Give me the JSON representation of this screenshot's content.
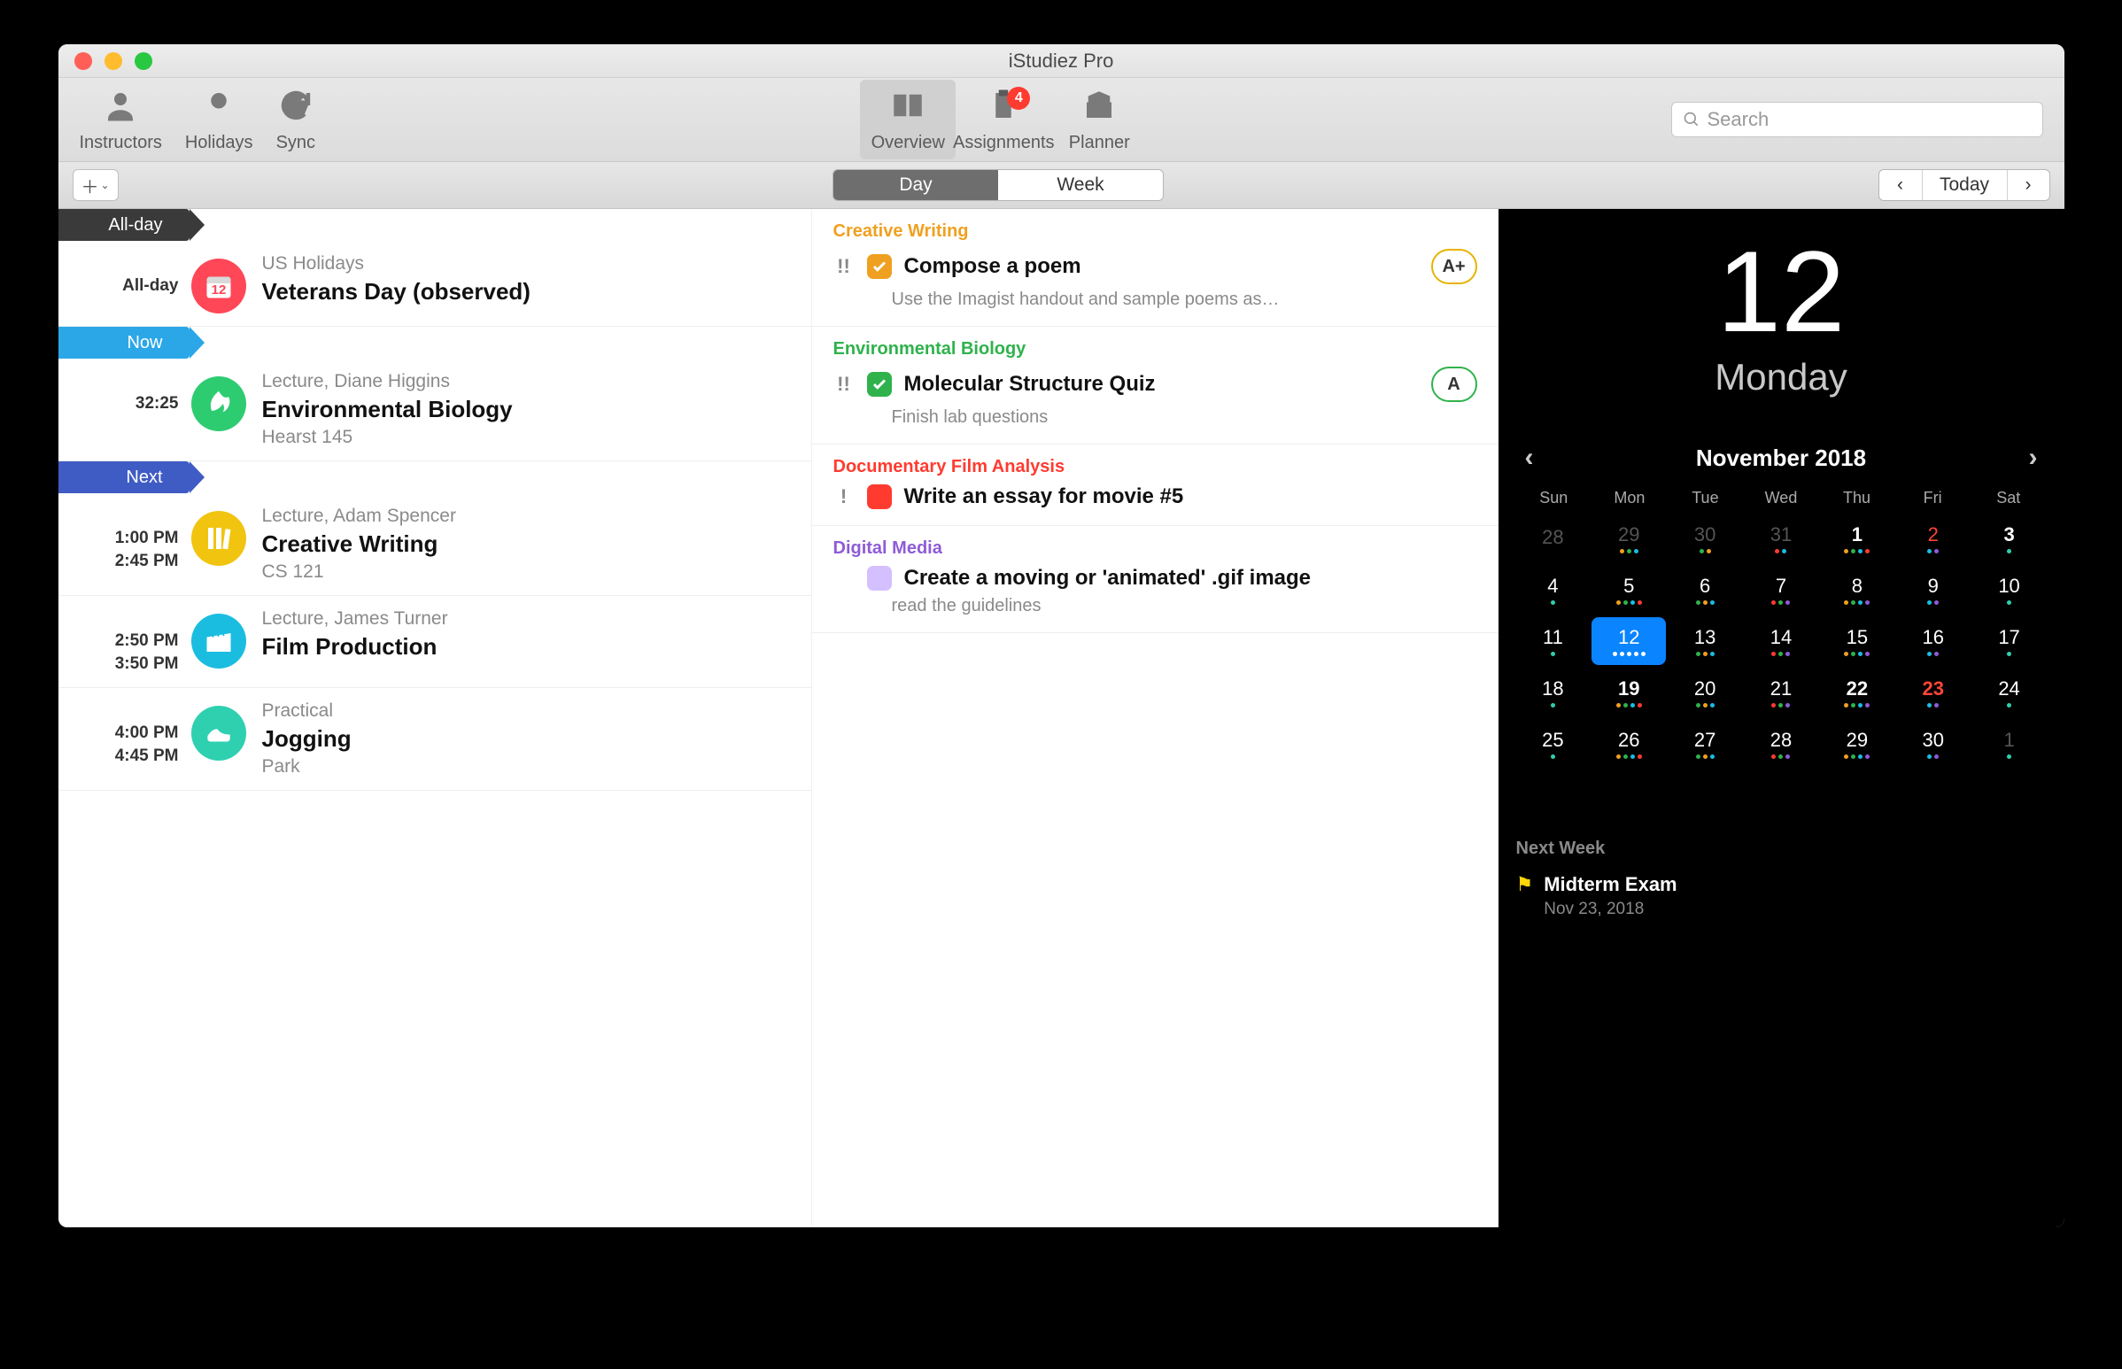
{
  "app": {
    "title": "iStudiez Pro"
  },
  "toolbar": {
    "left": [
      {
        "id": "instructors",
        "label": "Instructors"
      },
      {
        "id": "holidays",
        "label": "Holidays"
      },
      {
        "id": "sync",
        "label": "Sync"
      }
    ],
    "tabs": [
      {
        "id": "overview",
        "label": "Overview",
        "active": true,
        "badge": ""
      },
      {
        "id": "assignments",
        "label": "Assignments",
        "active": false,
        "badge": "4"
      },
      {
        "id": "planner",
        "label": "Planner",
        "active": false,
        "badge": ""
      }
    ],
    "search_placeholder": "Search"
  },
  "subbar": {
    "segments": [
      {
        "label": "Day",
        "on": true
      },
      {
        "label": "Week",
        "on": false
      }
    ],
    "today": "Today"
  },
  "markers": {
    "allday": "All-day",
    "now": "Now",
    "next": "Next"
  },
  "schedule": [
    {
      "marker": "allday",
      "time": "All-day",
      "color": "#ff4757",
      "icon": "calendar-icon",
      "iconText": "12",
      "subtitle": "US Holidays",
      "title": "Veterans Day (observed)",
      "location": ""
    },
    {
      "marker": "now",
      "time": "32:25",
      "color": "#2ecc71",
      "icon": "leaf-icon",
      "subtitle": "Lecture, Diane Higgins",
      "title": "Environmental Biology",
      "location": "Hearst 145"
    },
    {
      "marker": "next",
      "time": "1:00 PM\n2:45 PM",
      "color": "#f1c40f",
      "icon": "books-icon",
      "subtitle": "Lecture, Adam Spencer",
      "title": "Creative Writing",
      "location": "CS 121"
    },
    {
      "marker": "",
      "time": "2:50 PM\n3:50 PM",
      "color": "#1abde0",
      "icon": "clapper-icon",
      "subtitle": "Lecture, James Turner",
      "title": "Film Production",
      "location": ""
    },
    {
      "marker": "",
      "time": "4:00 PM\n4:45 PM",
      "color": "#2ed0b0",
      "icon": "shoe-icon",
      "subtitle": "Practical",
      "title": "Jogging",
      "location": "Park"
    }
  ],
  "tasks": [
    {
      "course": "Creative Writing",
      "course_color": "#f0a020",
      "priority": "!!",
      "box_color": "#f0a020",
      "checked": true,
      "title": "Compose a poem",
      "note": "Use the Imagist handout and sample poems as…",
      "grade": "A+",
      "grade_color": "#e6b400"
    },
    {
      "course": "Environmental Biology",
      "course_color": "#2fb24c",
      "priority": "!!",
      "box_color": "#2fb24c",
      "checked": true,
      "title": "Molecular Structure Quiz",
      "note": "Finish lab questions",
      "grade": "A",
      "grade_color": "#2fb24c"
    },
    {
      "course": "Documentary Film Analysis",
      "course_color": "#ff3b30",
      "priority": "!",
      "box_color": "#ff3b30",
      "checked": false,
      "title": "Write an essay for movie #5",
      "note": "",
      "grade": "",
      "grade_color": ""
    },
    {
      "course": "Digital Media",
      "course_color": "#8e5bd8",
      "priority": "",
      "box_color": "#b18cff",
      "checked": false,
      "title": "Create a moving or 'animated' .gif image",
      "note": "read the guidelines",
      "grade": "",
      "grade_color": ""
    }
  ],
  "sidebar": {
    "big_date": "12",
    "weekday": "Monday",
    "month": "November 2018",
    "weekdays": [
      "Sun",
      "Mon",
      "Tue",
      "Wed",
      "Thu",
      "Fri",
      "Sat"
    ],
    "cells": [
      {
        "n": "28",
        "dim": true,
        "dots": []
      },
      {
        "n": "29",
        "dim": true,
        "dots": [
          "#f0a020",
          "#2fb24c",
          "#1abde0"
        ]
      },
      {
        "n": "30",
        "dim": true,
        "dots": [
          "#2fb24c",
          "#f0a020"
        ]
      },
      {
        "n": "31",
        "dim": true,
        "dots": [
          "#ff3b30",
          "#1abde0"
        ]
      },
      {
        "n": "1",
        "bold": true,
        "dots": [
          "#f0a020",
          "#2fb24c",
          "#1abde0",
          "#ff3b30"
        ]
      },
      {
        "n": "2",
        "red": true,
        "dots": [
          "#1abde0",
          "#8e5bd8"
        ]
      },
      {
        "n": "3",
        "bold": true,
        "dots": [
          "#2ed0b0"
        ]
      },
      {
        "n": "4",
        "dots": [
          "#2ed0b0"
        ]
      },
      {
        "n": "5",
        "dots": [
          "#f0a020",
          "#2fb24c",
          "#1abde0",
          "#ff3b30"
        ]
      },
      {
        "n": "6",
        "dots": [
          "#2fb24c",
          "#f0a020",
          "#1abde0"
        ]
      },
      {
        "n": "7",
        "dots": [
          "#ff3b30",
          "#2fb24c",
          "#8e5bd8"
        ]
      },
      {
        "n": "8",
        "dots": [
          "#f0a020",
          "#2fb24c",
          "#1abde0",
          "#8e5bd8"
        ]
      },
      {
        "n": "9",
        "dots": [
          "#1abde0",
          "#8e5bd8"
        ]
      },
      {
        "n": "10",
        "dots": [
          "#2ed0b0"
        ]
      },
      {
        "n": "11",
        "dots": [
          "#2ed0b0"
        ]
      },
      {
        "n": "12",
        "sel": true,
        "dots": [
          "#fff",
          "#fff",
          "#fff",
          "#fff",
          "#fff"
        ]
      },
      {
        "n": "13",
        "dots": [
          "#2fb24c",
          "#f0a020",
          "#1abde0"
        ]
      },
      {
        "n": "14",
        "dots": [
          "#ff3b30",
          "#2fb24c",
          "#8e5bd8"
        ]
      },
      {
        "n": "15",
        "dots": [
          "#f0a020",
          "#2fb24c",
          "#1abde0",
          "#8e5bd8"
        ]
      },
      {
        "n": "16",
        "dots": [
          "#1abde0",
          "#8e5bd8"
        ]
      },
      {
        "n": "17",
        "dots": [
          "#2ed0b0"
        ]
      },
      {
        "n": "18",
        "dots": [
          "#2ed0b0"
        ]
      },
      {
        "n": "19",
        "bold": true,
        "dots": [
          "#f0a020",
          "#2fb24c",
          "#1abde0",
          "#ff3b30"
        ]
      },
      {
        "n": "20",
        "dots": [
          "#2fb24c",
          "#f0a020",
          "#1abde0"
        ]
      },
      {
        "n": "21",
        "dots": [
          "#ff3b30",
          "#2fb24c",
          "#8e5bd8"
        ]
      },
      {
        "n": "22",
        "bold": true,
        "dots": [
          "#f0a020",
          "#2fb24c",
          "#1abde0",
          "#8e5bd8"
        ]
      },
      {
        "n": "23",
        "red": true,
        "bold": true,
        "dots": [
          "#1abde0",
          "#8e5bd8"
        ]
      },
      {
        "n": "24",
        "dots": [
          "#2ed0b0"
        ]
      },
      {
        "n": "25",
        "dots": [
          "#2ed0b0"
        ]
      },
      {
        "n": "26",
        "dots": [
          "#f0a020",
          "#2fb24c",
          "#1abde0",
          "#ff3b30"
        ]
      },
      {
        "n": "27",
        "dots": [
          "#2fb24c",
          "#f0a020",
          "#1abde0"
        ]
      },
      {
        "n": "28",
        "dots": [
          "#ff3b30",
          "#2fb24c",
          "#8e5bd8"
        ]
      },
      {
        "n": "29",
        "dots": [
          "#f0a020",
          "#2fb24c",
          "#1abde0",
          "#8e5bd8"
        ]
      },
      {
        "n": "30",
        "dots": [
          "#1abde0",
          "#8e5bd8"
        ]
      },
      {
        "n": "1",
        "dim": true,
        "dots": [
          "#2ed0b0"
        ]
      }
    ],
    "nextweek_label": "Next Week",
    "upcoming": {
      "title": "Midterm Exam",
      "date": "Nov 23, 2018"
    }
  }
}
